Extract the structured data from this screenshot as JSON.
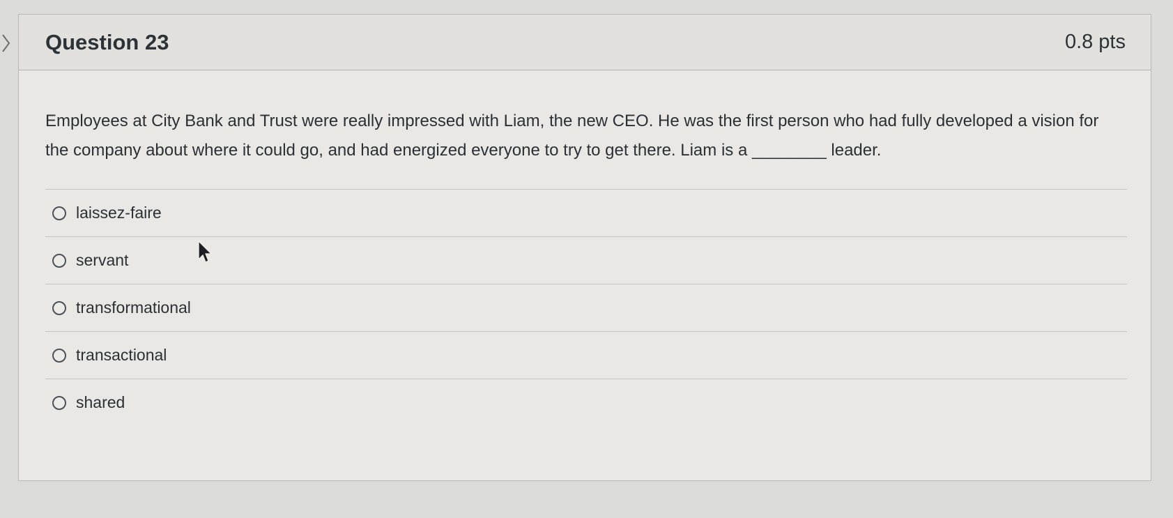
{
  "question": {
    "title": "Question 23",
    "points": "0.8 pts",
    "text": "Employees at City Bank and Trust were really impressed with Liam, the new CEO. He was the first person who had fully developed a vision for the company about where it could go, and had energized everyone to try to get there. Liam is a ________ leader."
  },
  "answers": [
    {
      "label": "laissez-faire"
    },
    {
      "label": "servant"
    },
    {
      "label": "transformational"
    },
    {
      "label": "transactional"
    },
    {
      "label": "shared"
    }
  ],
  "icons": {
    "nav": "chevron-right-icon",
    "option": "radio-unchecked-icon",
    "pointer": "mouse-cursor-icon"
  },
  "colors": {
    "text": "#2a3035",
    "card_background": "#e9e8e4",
    "header_background": "#e2e1dd",
    "border": "#b4b3af"
  }
}
